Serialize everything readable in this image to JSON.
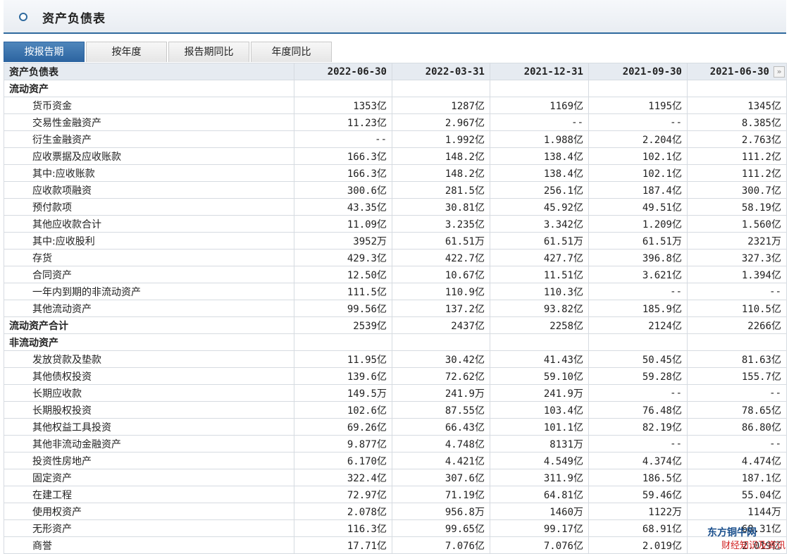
{
  "header": {
    "title": "资产负债表"
  },
  "tabs": [
    {
      "label": "按报告期",
      "active": true
    },
    {
      "label": "按年度",
      "active": false
    },
    {
      "label": "报告期同比",
      "active": false
    },
    {
      "label": "年度同比",
      "active": false
    }
  ],
  "table": {
    "columns": [
      "资产负债表",
      "2022-06-30",
      "2022-03-31",
      "2021-12-31",
      "2021-09-30",
      "2021-06-30"
    ],
    "scroll_icon": "double-chevron-right-icon",
    "rows": [
      {
        "type": "section",
        "label": "流动资产",
        "values": [
          "",
          "",
          "",
          "",
          ""
        ]
      },
      {
        "type": "item",
        "label": "货币资金",
        "values": [
          "1353亿",
          "1287亿",
          "1169亿",
          "1195亿",
          "1345亿"
        ]
      },
      {
        "type": "item",
        "label": "交易性金融资产",
        "values": [
          "11.23亿",
          "2.967亿",
          "--",
          "--",
          "8.385亿"
        ]
      },
      {
        "type": "item",
        "label": "衍生金融资产",
        "values": [
          "--",
          "1.992亿",
          "1.988亿",
          "2.204亿",
          "2.763亿"
        ]
      },
      {
        "type": "item",
        "label": "应收票据及应收账款",
        "values": [
          "166.3亿",
          "148.2亿",
          "138.4亿",
          "102.1亿",
          "111.2亿"
        ]
      },
      {
        "type": "item",
        "label": "其中:应收账款",
        "values": [
          "166.3亿",
          "148.2亿",
          "138.4亿",
          "102.1亿",
          "111.2亿"
        ]
      },
      {
        "type": "item",
        "label": "应收款项融资",
        "values": [
          "300.6亿",
          "281.5亿",
          "256.1亿",
          "187.4亿",
          "300.7亿"
        ]
      },
      {
        "type": "item",
        "label": "预付款项",
        "values": [
          "43.35亿",
          "30.81亿",
          "45.92亿",
          "49.51亿",
          "58.19亿"
        ]
      },
      {
        "type": "item",
        "label": "其他应收款合计",
        "values": [
          "11.09亿",
          "3.235亿",
          "3.342亿",
          "1.209亿",
          "1.560亿"
        ]
      },
      {
        "type": "item",
        "label": "其中:应收股利",
        "values": [
          "3952万",
          "61.51万",
          "61.51万",
          "61.51万",
          "2321万"
        ]
      },
      {
        "type": "item",
        "label": "存货",
        "values": [
          "429.3亿",
          "422.7亿",
          "427.7亿",
          "396.8亿",
          "327.3亿"
        ]
      },
      {
        "type": "item",
        "label": "合同资产",
        "values": [
          "12.50亿",
          "10.67亿",
          "11.51亿",
          "3.621亿",
          "1.394亿"
        ]
      },
      {
        "type": "item",
        "label": "一年内到期的非流动资产",
        "values": [
          "111.5亿",
          "110.9亿",
          "110.3亿",
          "--",
          "--"
        ]
      },
      {
        "type": "item",
        "label": "其他流动资产",
        "values": [
          "99.56亿",
          "137.2亿",
          "93.82亿",
          "185.9亿",
          "110.5亿"
        ]
      },
      {
        "type": "total",
        "label": "流动资产合计",
        "values": [
          "2539亿",
          "2437亿",
          "2258亿",
          "2124亿",
          "2266亿"
        ]
      },
      {
        "type": "section",
        "label": "非流动资产",
        "values": [
          "",
          "",
          "",
          "",
          ""
        ]
      },
      {
        "type": "item",
        "label": "发放贷款及垫款",
        "values": [
          "11.95亿",
          "30.42亿",
          "41.43亿",
          "50.45亿",
          "81.63亿"
        ]
      },
      {
        "type": "item",
        "label": "其他债权投资",
        "values": [
          "139.6亿",
          "72.62亿",
          "59.10亿",
          "59.28亿",
          "155.7亿"
        ]
      },
      {
        "type": "item",
        "label": "长期应收款",
        "values": [
          "149.5万",
          "241.9万",
          "241.9万",
          "--",
          "--"
        ]
      },
      {
        "type": "item",
        "label": "长期股权投资",
        "values": [
          "102.6亿",
          "87.55亿",
          "103.4亿",
          "76.48亿",
          "78.65亿"
        ]
      },
      {
        "type": "item",
        "label": "其他权益工具投资",
        "values": [
          "69.26亿",
          "66.43亿",
          "101.1亿",
          "82.19亿",
          "86.80亿"
        ]
      },
      {
        "type": "item",
        "label": "其他非流动金融资产",
        "values": [
          "9.877亿",
          "4.748亿",
          "8131万",
          "--",
          "--"
        ]
      },
      {
        "type": "item",
        "label": "投资性房地产",
        "values": [
          "6.170亿",
          "4.421亿",
          "4.549亿",
          "4.374亿",
          "4.474亿"
        ]
      },
      {
        "type": "item",
        "label": "固定资产",
        "values": [
          "322.4亿",
          "307.6亿",
          "311.9亿",
          "186.5亿",
          "187.1亿"
        ]
      },
      {
        "type": "item",
        "label": "在建工程",
        "values": [
          "72.97亿",
          "71.19亿",
          "64.81亿",
          "59.46亿",
          "55.04亿"
        ]
      },
      {
        "type": "item",
        "label": "使用权资产",
        "values": [
          "2.078亿",
          "956.8万",
          "1460万",
          "1122万",
          "1144万"
        ]
      },
      {
        "type": "item",
        "label": "无形资产",
        "values": [
          "116.3亿",
          "99.65亿",
          "99.17亿",
          "68.91亿",
          "68.31亿"
        ]
      },
      {
        "type": "item",
        "label": "商誉",
        "values": [
          "17.71亿",
          "7.076亿",
          "7.076亿",
          "2.019亿",
          "2.019亿"
        ]
      }
    ]
  },
  "watermark": {
    "line1": "东方铜牛网",
    "line2": "财经知识及资讯"
  }
}
